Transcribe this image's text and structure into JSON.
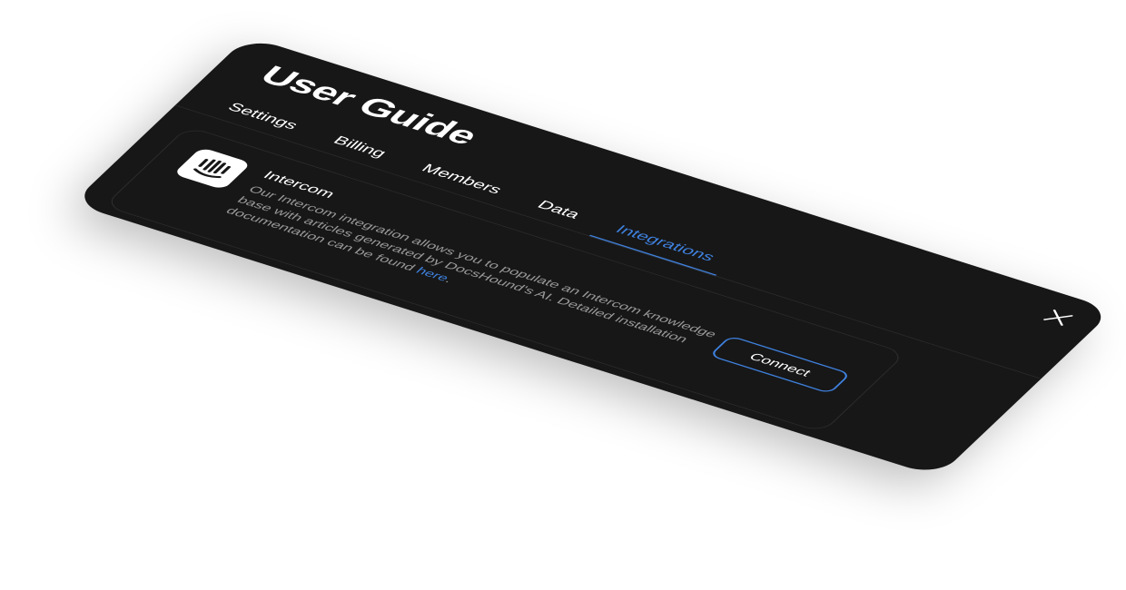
{
  "modal": {
    "title": "User Guide",
    "tabs": [
      {
        "label": "Settings",
        "active": false
      },
      {
        "label": "Billing",
        "active": false
      },
      {
        "label": "Members",
        "active": false
      },
      {
        "label": "Data",
        "active": false
      },
      {
        "label": "Integrations",
        "active": true
      }
    ],
    "close_icon": "close-icon"
  },
  "integration": {
    "name": "Intercom",
    "logo_icon": "intercom-logo-icon",
    "description_before_link": "Our Intercom integration allows you to populate an Intercom knowledge base with articles generated by DocsHound's AI. Detailed installation documentation can be found ",
    "link_text": "here",
    "description_after_link": ".",
    "connect_label": "Connect"
  },
  "colors": {
    "background": "#171717",
    "accent": "#3f82e0",
    "text_muted": "#9a9a9a"
  }
}
